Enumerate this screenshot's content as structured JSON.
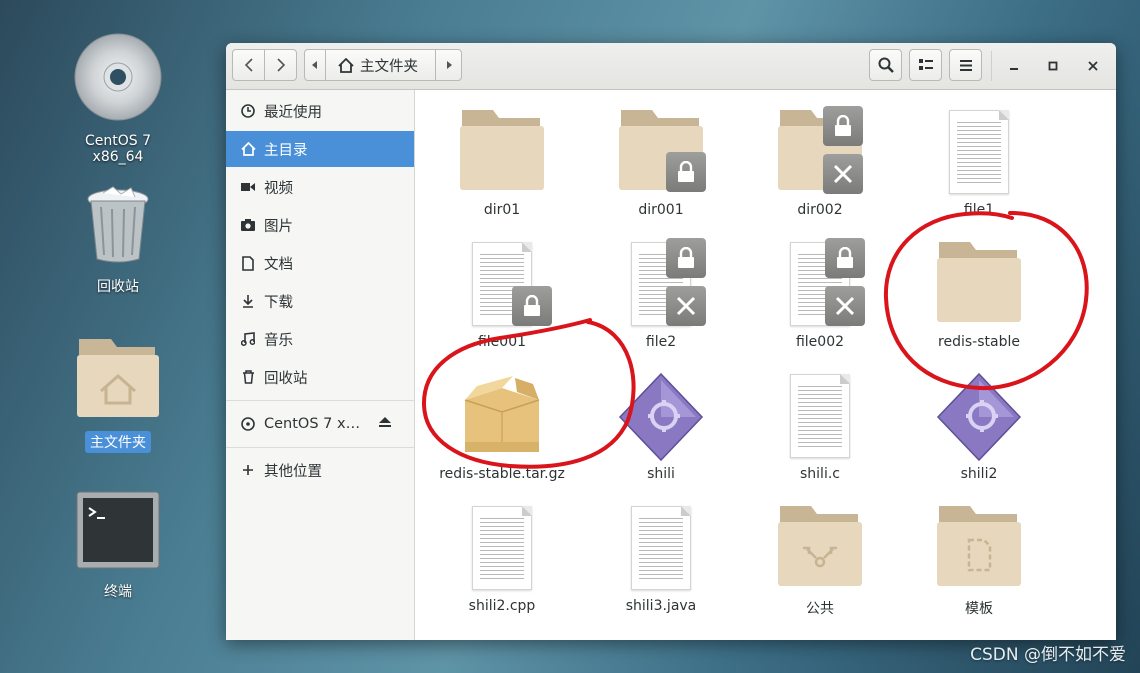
{
  "desktop": {
    "icons": [
      {
        "label": "CentOS 7 x86_64",
        "icon": "cd-icon"
      },
      {
        "label": "回收站",
        "icon": "trash-icon"
      },
      {
        "label": "主文件夹",
        "icon": "home-folder-icon"
      },
      {
        "label": "终端",
        "icon": "terminal-icon"
      }
    ]
  },
  "toolbar": {
    "back_icon": "chevron-left-icon",
    "forward_icon": "chevron-right-icon",
    "path_label": "主文件夹",
    "search_icon": "search-icon",
    "view_icon": "list-view-icon",
    "menu_icon": "hamburger-menu-icon"
  },
  "sidebar": {
    "items": [
      {
        "label": "最近使用",
        "icon": "recent-icon"
      },
      {
        "label": "主目录",
        "icon": "home-icon",
        "active": true
      },
      {
        "label": "视频",
        "icon": "video-icon"
      },
      {
        "label": "图片",
        "icon": "camera-icon"
      },
      {
        "label": "文档",
        "icon": "document-icon"
      },
      {
        "label": "下载",
        "icon": "download-icon"
      },
      {
        "label": "音乐",
        "icon": "music-icon"
      },
      {
        "label": "回收站",
        "icon": "trash-icon"
      },
      {
        "label": "CentOS 7 x…",
        "icon": "disc-icon"
      },
      {
        "label": "其他位置",
        "icon": "plus-icon"
      }
    ]
  },
  "files": [
    {
      "name": "dir01",
      "type": "folder"
    },
    {
      "name": "dir001",
      "type": "folder",
      "emblems": [
        "lock"
      ]
    },
    {
      "name": "dir002",
      "type": "folder",
      "emblems": [
        "lock",
        "x"
      ]
    },
    {
      "name": "file1",
      "type": "text"
    },
    {
      "name": "file001",
      "type": "text",
      "emblems": [
        "lock"
      ]
    },
    {
      "name": "file2",
      "type": "text",
      "emblems": [
        "lock",
        "x"
      ]
    },
    {
      "name": "file002",
      "type": "text",
      "emblems": [
        "lock",
        "x"
      ]
    },
    {
      "name": "redis-stable",
      "type": "folder"
    },
    {
      "name": "redis-stable.tar.gz",
      "type": "archive"
    },
    {
      "name": "shili",
      "type": "executable"
    },
    {
      "name": "shili.c",
      "type": "text"
    },
    {
      "name": "shili2",
      "type": "executable"
    },
    {
      "name": "shili2.cpp",
      "type": "text"
    },
    {
      "name": "shili3.java",
      "type": "text"
    },
    {
      "name": "公共",
      "type": "folder-share"
    },
    {
      "name": "模板",
      "type": "folder-template"
    }
  ],
  "colors": {
    "accent": "#4a90d9",
    "folder": "#e3d3b8",
    "annotation": "#d9141b"
  },
  "watermark": "CSDN @倒不如不爱"
}
